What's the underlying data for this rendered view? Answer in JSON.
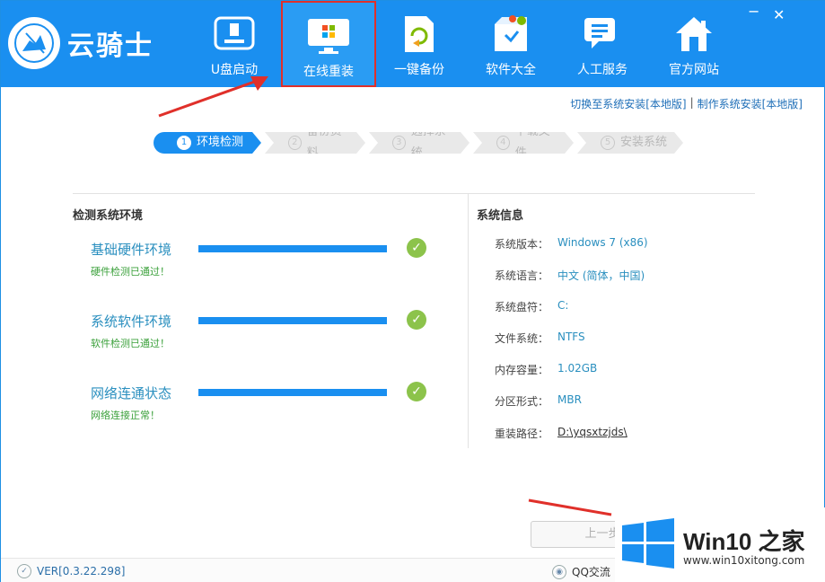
{
  "app": {
    "logo_text": "云骑士",
    "window_controls": {
      "minimize": "−",
      "close": "✕"
    }
  },
  "nav": {
    "usb": "U盘启动",
    "online": "在线重装",
    "backup": "一键备份",
    "software": "软件大全",
    "service": "人工服务",
    "site": "官方网站"
  },
  "sublinks": {
    "local_install": "切换至系统安装[本地版]",
    "separator": "|",
    "make_install": "制作系统安装[本地版]"
  },
  "steps": [
    {
      "num": "1",
      "label": "环境检测"
    },
    {
      "num": "2",
      "label": "备份资料"
    },
    {
      "num": "3",
      "label": "选择系统"
    },
    {
      "num": "4",
      "label": "下载文件"
    },
    {
      "num": "5",
      "label": "安装系统"
    }
  ],
  "detect": {
    "title": "检测系统环境",
    "items": [
      {
        "name": "基础硬件环境",
        "status": "硬件检测已通过！",
        "progress": 1.0
      },
      {
        "name": "系统软件环境",
        "status": "软件检测已通过！",
        "progress": 1.0
      },
      {
        "name": "网络连通状态",
        "status": "网络连接正常！",
        "progress": 1.0
      }
    ],
    "ok_icon": "✓"
  },
  "sysinfo": {
    "title": "系统信息",
    "rows": [
      {
        "label": "系统版本：",
        "value": "Windows 7 (x86)"
      },
      {
        "label": "系统语言：",
        "value": "中文 (简体，中国)"
      },
      {
        "label": "系统盘符：",
        "value": "C:"
      },
      {
        "label": "文件系统：",
        "value": "NTFS"
      },
      {
        "label": "内存容量：",
        "value": "1.02GB"
      },
      {
        "label": "分区形式：",
        "value": "MBR"
      },
      {
        "label": "重装路径：",
        "value": "D:\\yqsxtzjds\\"
      }
    ]
  },
  "footer": {
    "prev_button": "上一步",
    "version": "VER[0.3.22.298]",
    "qq": "QQ交流"
  },
  "watermark": {
    "title": "Win10 之家",
    "url": "www.win10xitong.com"
  },
  "colors": {
    "primary": "#1a8ff0",
    "ok": "#8cc34b",
    "highlight_border": "#e0302a"
  }
}
